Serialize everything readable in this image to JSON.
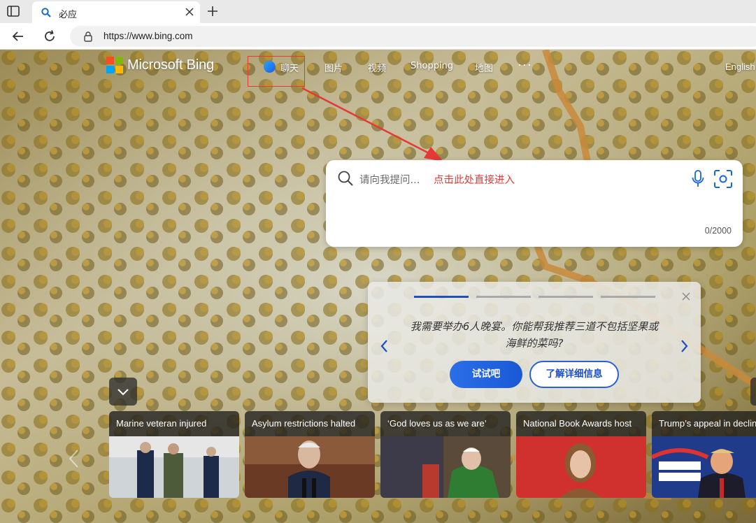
{
  "browser": {
    "tab_title": "必应",
    "url": "https://www.bing.com"
  },
  "header": {
    "logo_text": "Microsoft Bing",
    "nav": [
      {
        "label": "聊天"
      },
      {
        "label": "图片"
      },
      {
        "label": "视频"
      },
      {
        "label": "Shopping"
      },
      {
        "label": "地图"
      }
    ],
    "more": "···",
    "language": "English"
  },
  "search": {
    "placeholder": "请向我提问...",
    "annotation": "点击此处直接进入",
    "counter": "0/2000"
  },
  "promo": {
    "text": "我需要举办6人晚宴。你能帮我推荐三道不包括坚果或海鲜的菜吗?",
    "try_label": "试试吧",
    "learn_label": "了解详细信息",
    "active_index": 0,
    "total": 5
  },
  "news": [
    {
      "title": "Marine veteran injured"
    },
    {
      "title": "Asylum restrictions halted"
    },
    {
      "title": "‘God loves us as we are’"
    },
    {
      "title": "National Book Awards host"
    },
    {
      "title": "Trump’s appeal in decline"
    }
  ],
  "colors": {
    "accent": "#2b6fe8",
    "annotation": "#e53935"
  }
}
